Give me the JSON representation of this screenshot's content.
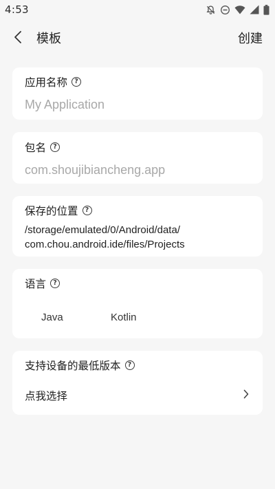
{
  "status_bar": {
    "time": "4:53",
    "icons": [
      "notifications-off-icon",
      "do-not-disturb-icon",
      "wifi-icon",
      "cellular-signal-icon",
      "battery-icon"
    ]
  },
  "app_bar": {
    "title": "模板",
    "action": "创建",
    "back_icon": "chevron-left-icon"
  },
  "app_name": {
    "label": "应用名称",
    "placeholder": "My Application"
  },
  "package_name": {
    "label": "包名",
    "placeholder": "com.shoujibiancheng.app"
  },
  "save_location": {
    "label": "保存的位置",
    "value": "/storage/emulated/0/Android/data/\ncom.chou.android.ide/files/Projects"
  },
  "language": {
    "label": "语言",
    "options": [
      "Java",
      "Kotlin"
    ]
  },
  "min_sdk": {
    "label": "支持设备的最低版本",
    "value": "点我选择"
  },
  "help_glyph": "?"
}
